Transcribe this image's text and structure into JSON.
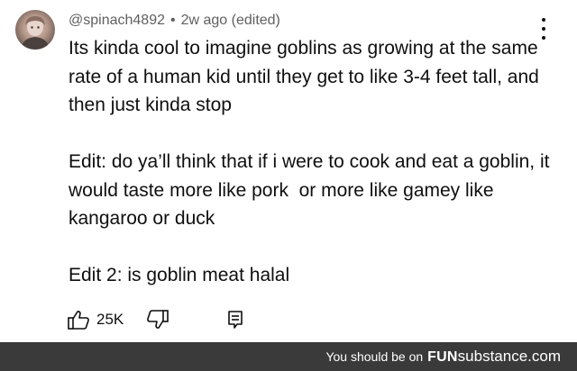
{
  "comment": {
    "author": "@spinach4892",
    "separator": "•",
    "timestamp": "2w ago (edited)",
    "paragraphs": [
      "Its kinda cool to imagine goblins as growing at the same rate of a human kid until they get to like 3-4 feet tall, and then just kinda stop",
      "Edit: do ya’ll think that if i were to cook and eat a goblin, it would taste more like pork  or more like gamey like kangaroo or duck",
      "Edit 2: is goblin meat halal"
    ],
    "like_count": "25K",
    "icons": {
      "like": "thumbs-up-icon",
      "dislike": "thumbs-down-icon",
      "reply": "reply-icon",
      "menu": "more-vertical-icon"
    }
  },
  "footer": {
    "text": "You should be on",
    "brand_bold": "FUN",
    "brand_light": "substance.com"
  },
  "colors": {
    "text": "#0f0f0f",
    "meta": "#606060",
    "footer_bg": "#3a3a3a"
  }
}
